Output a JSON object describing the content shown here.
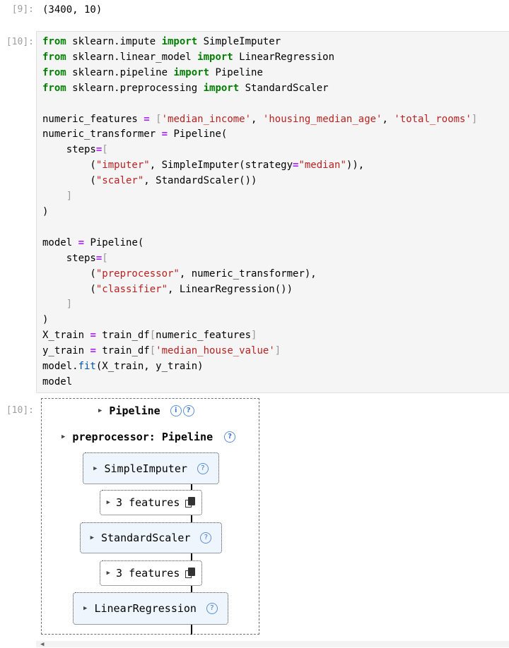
{
  "cells": {
    "out9": {
      "prompt": "[9]:",
      "text": "(3400, 10)"
    },
    "in10": {
      "prompt": "[10]:"
    },
    "out10": {
      "prompt": "[10]:"
    }
  },
  "code_lines": {
    "l1": {
      "kw1": "from",
      "mod": " sklearn.impute ",
      "kw2": "import",
      "name": " SimpleImputer"
    },
    "l2": {
      "kw1": "from",
      "mod": " sklearn.linear_model ",
      "kw2": "import",
      "name": " LinearRegression"
    },
    "l3": {
      "kw1": "from",
      "mod": " sklearn.pipeline ",
      "kw2": "import",
      "name": " Pipeline"
    },
    "l4": {
      "kw1": "from",
      "mod": " sklearn.preprocessing ",
      "kw2": "import",
      "name": " StandardScaler"
    },
    "l6": {
      "a": "numeric_features ",
      "eq": "=",
      "b": " ",
      "lb": "[",
      "s1": "'median_income'",
      "c1": ", ",
      "s2": "'housing_median_age'",
      "c2": ", ",
      "s3": "'total_rooms'",
      "rb": "]"
    },
    "l7": {
      "a": "numeric_transformer ",
      "eq": "=",
      "b": " Pipeline("
    },
    "l8": {
      "a": "    steps",
      "eq": "=",
      "lb": "["
    },
    "l9": {
      "a": "        (",
      "s1": "\"imputer\"",
      "b": ", SimpleImputer(strategy",
      "eq": "=",
      "s2": "\"median\"",
      "c": ")),"
    },
    "l10": {
      "a": "        (",
      "s1": "\"scaler\"",
      "b": ", StandardScaler())"
    },
    "l11": {
      "a": "    ",
      "rb": "]"
    },
    "l12": {
      "a": ")"
    },
    "l14": {
      "a": "model ",
      "eq": "=",
      "b": " Pipeline("
    },
    "l15": {
      "a": "    steps",
      "eq": "=",
      "lb": "["
    },
    "l16": {
      "a": "        (",
      "s1": "\"preprocessor\"",
      "b": ", numeric_transformer),"
    },
    "l17": {
      "a": "        (",
      "s1": "\"classifier\"",
      "b": ", LinearRegression())"
    },
    "l18": {
      "a": "    ",
      "rb": "]"
    },
    "l19": {
      "a": ")"
    },
    "l20": {
      "a": "X_train ",
      "eq": "=",
      "b": " train_df",
      "lb": "[",
      "c": "numeric_features",
      "rb": "]"
    },
    "l21": {
      "a": "y_train ",
      "eq": "=",
      "b": " train_df",
      "lb": "[",
      "s1": "'median_house_value'",
      "rb": "]"
    },
    "l22": {
      "a": "model.",
      "fn": "fit",
      "b": "(X_train, y_train)"
    },
    "l23": {
      "a": "model"
    }
  },
  "diagram": {
    "pipeline": {
      "label": "Pipeline",
      "info_icon": "i",
      "help_icon": "?"
    },
    "preprocessor": {
      "label": "preprocessor: Pipeline",
      "help_icon": "?"
    },
    "imputer": {
      "label": "SimpleImputer",
      "help_icon": "?"
    },
    "features1": {
      "label": "3 features"
    },
    "scaler": {
      "label": "StandardScaler",
      "help_icon": "?"
    },
    "features2": {
      "label": "3 features"
    },
    "regressor": {
      "label": "LinearRegression",
      "help_icon": "?"
    }
  }
}
